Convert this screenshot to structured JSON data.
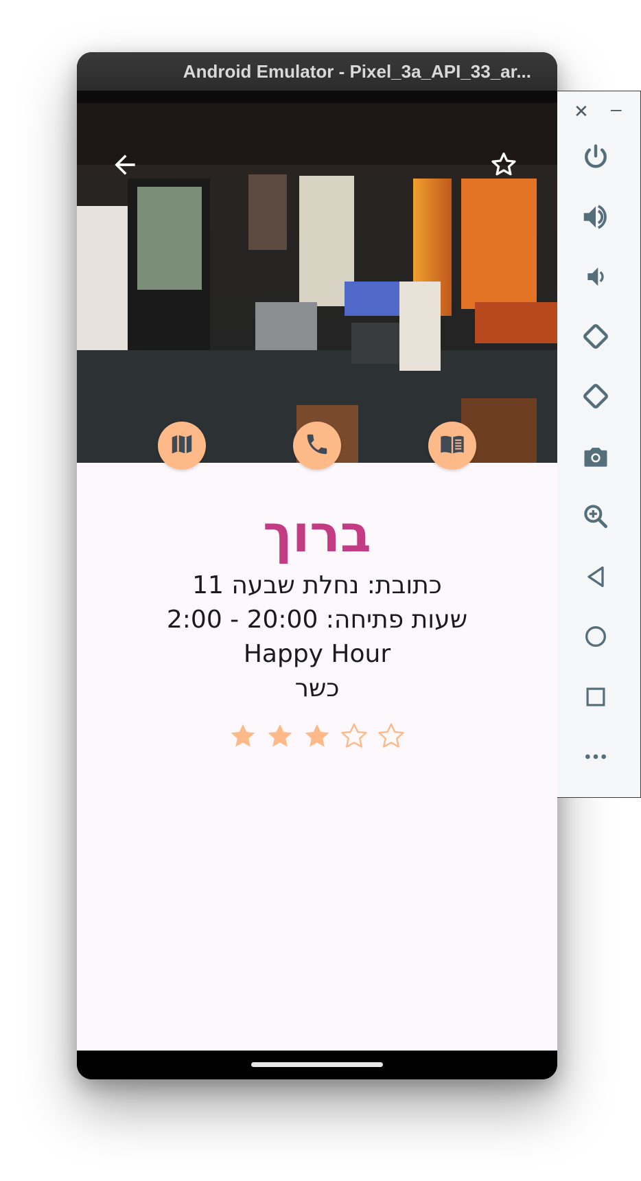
{
  "window": {
    "title": "Android Emulator - Pixel_3a_API_33_ar..."
  },
  "venue": {
    "name": "ברוך",
    "address": "כתובת: נחלת שבעה 11",
    "hours": "שעות פתיחה: 20:00 - 2:00",
    "happy_hour": "Happy Hour",
    "kosher": "כשר",
    "rating": 3,
    "rating_max": 5
  },
  "actions": [
    {
      "name": "map-button",
      "icon": "map-icon"
    },
    {
      "name": "phone-button",
      "icon": "phone-icon"
    },
    {
      "name": "menu-button",
      "icon": "menu-book-icon"
    }
  ],
  "top_bar": {
    "back_icon": "arrow-back-icon",
    "favorite_icon": "star-outline-icon"
  },
  "colors": {
    "accent": "#c33b82",
    "button": "#fdb988",
    "star": "#fdb988",
    "background": "#fdf8fb"
  },
  "toolbar": {
    "items": [
      "power-icon",
      "volume-up-icon",
      "volume-down-icon",
      "rotate-left-icon",
      "rotate-right-icon",
      "camera-icon",
      "zoom-icon",
      "back-icon",
      "home-icon",
      "overview-icon",
      "more-icon"
    ]
  }
}
